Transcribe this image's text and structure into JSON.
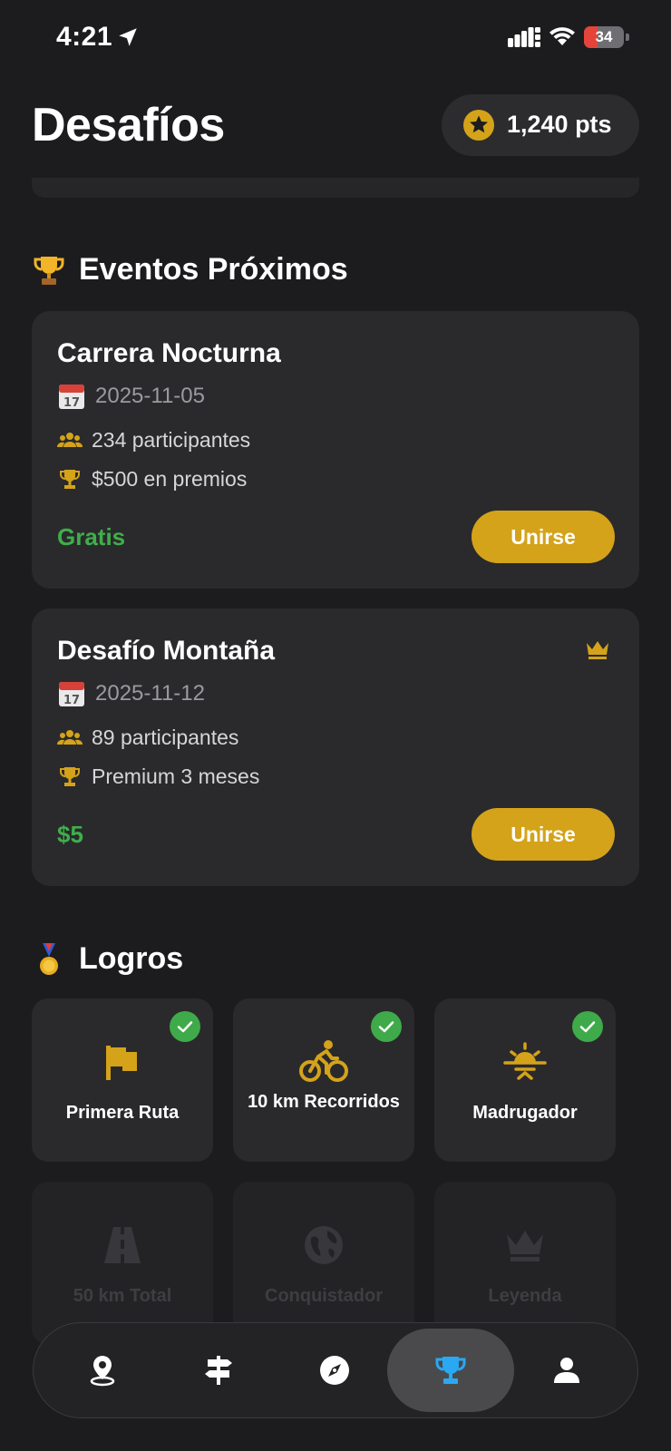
{
  "status": {
    "time": "4:21",
    "battery": "34",
    "battery_level": 0.34
  },
  "header": {
    "title": "Desafíos",
    "points": "1,240 pts"
  },
  "events_section": {
    "title": "Eventos Próximos",
    "events": [
      {
        "title": "Carrera Nocturna",
        "date": "2025-11-05",
        "participants": "234 participantes",
        "prize": "$500 en premios",
        "price": "Gratis",
        "join_label": "Unirse",
        "premium": false
      },
      {
        "title": "Desafío Montaña",
        "date": "2025-11-12",
        "participants": "89 participantes",
        "prize": "Premium 3 meses",
        "price": "$5",
        "join_label": "Unirse",
        "premium": true
      }
    ]
  },
  "achievements_section": {
    "title": "Logros",
    "items": [
      {
        "label": "Primera Ruta",
        "icon": "flag-icon",
        "unlocked": true
      },
      {
        "label": "10 km Recorridos",
        "icon": "bicycle-icon",
        "unlocked": true
      },
      {
        "label": "Madrugador",
        "icon": "sunrise-icon",
        "unlocked": true
      },
      {
        "label": "50 km Total",
        "icon": "road-icon",
        "unlocked": false
      },
      {
        "label": "Conquistador",
        "icon": "globe-icon",
        "unlocked": false
      },
      {
        "label": "Leyenda",
        "icon": "crown-icon",
        "unlocked": false
      }
    ]
  },
  "tab_bar": {
    "tabs": [
      {
        "icon": "map-pin-icon"
      },
      {
        "icon": "signpost-icon"
      },
      {
        "icon": "compass-icon"
      },
      {
        "icon": "trophy-icon",
        "active": true
      },
      {
        "icon": "user-icon"
      }
    ]
  },
  "colors": {
    "accent": "#D4A31A",
    "green": "#3FAE4B",
    "active_tab": "#2AA8F2",
    "background": "#1C1C1E",
    "card": "#2A2A2C"
  }
}
